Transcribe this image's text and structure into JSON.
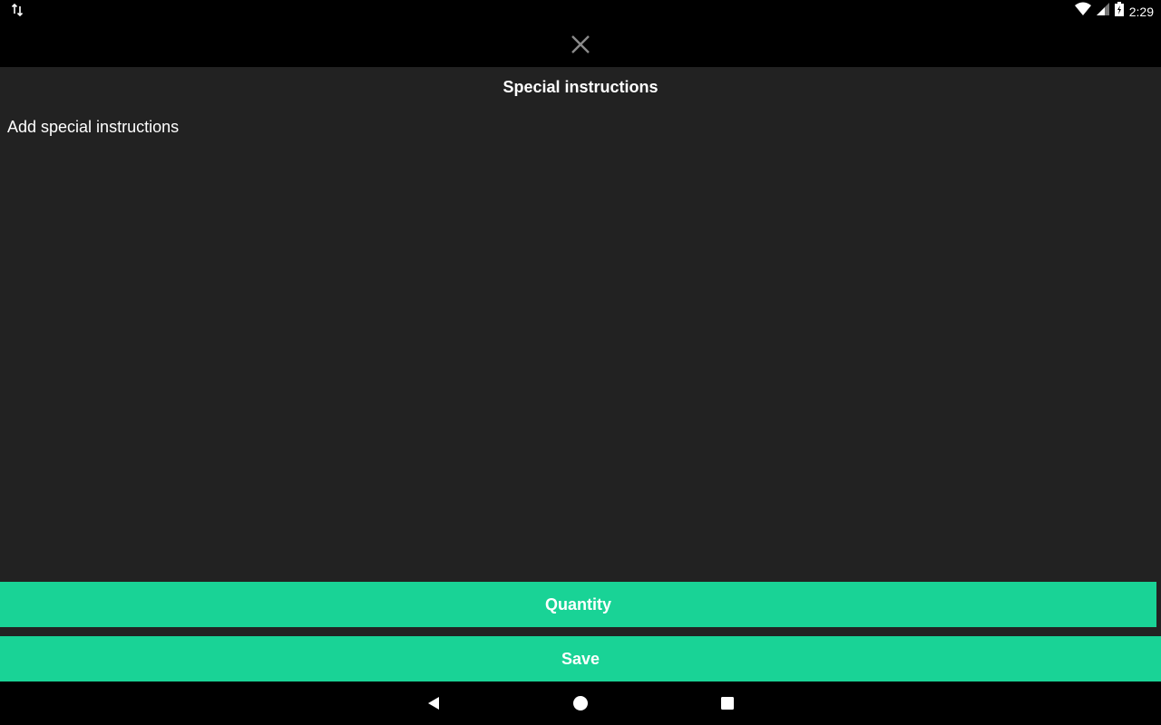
{
  "status_bar": {
    "time": "2:29",
    "icons": [
      "data-transfer-icon",
      "wifi-icon",
      "signal-icon",
      "battery-charging-icon"
    ]
  },
  "toolbar": {
    "close_icon": "close-icon"
  },
  "dialog": {
    "title": "Special instructions",
    "input_placeholder": "Add special instructions",
    "input_value": ""
  },
  "actions": {
    "quantity_label": "Quantity",
    "save_label": "Save"
  },
  "colors": {
    "accent": "#19d396",
    "background": "#222222",
    "bars": "#000000"
  },
  "nav_bar": {
    "icons": [
      "back-icon",
      "home-icon",
      "recents-icon"
    ]
  }
}
